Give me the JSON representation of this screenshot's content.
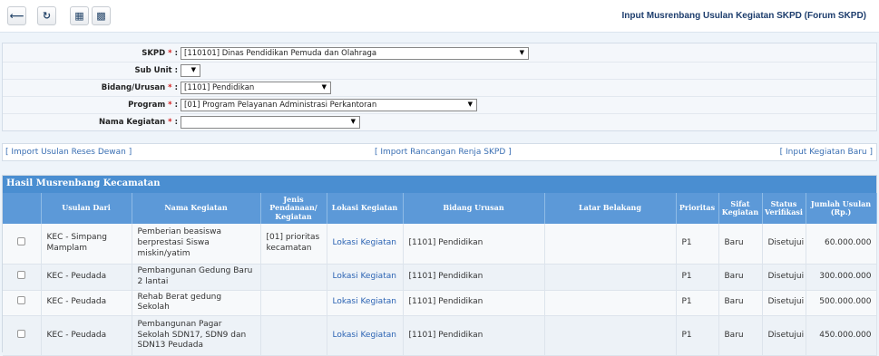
{
  "toolbar": {
    "back_icon": "arrow-left-icon",
    "refresh_icon": "refresh-icon",
    "calc_icon": "calculator-icon",
    "save_icon": "save-icon"
  },
  "page_title": "Input Musrenbang Usulan Kegiatan SKPD (Forum SKPD)",
  "form": {
    "skpd": {
      "label": "SKPD",
      "required": "*",
      "value": "[110101] Dinas Pendidikan Pemuda dan Olahraga"
    },
    "sub_unit": {
      "label": "Sub Unit",
      "value": ""
    },
    "bidang": {
      "label": "Bidang/Urusan",
      "required": "*",
      "value": "[1101] Pendidikan"
    },
    "program": {
      "label": "Program",
      "required": "*",
      "value": "[01] Program Pelayanan Administrasi Perkantoran"
    },
    "kegiatan": {
      "label": "Nama Kegiatan",
      "required": "*",
      "value": ""
    },
    "colon": ":"
  },
  "links": {
    "import_reses": "[ Import Usulan Reses Dewan ]",
    "import_renja": "[ Import Rancangan Renja SKPD ]",
    "input_baru": "[ Input Kegiatan Baru ]"
  },
  "results": {
    "title": "Hasil Musrenbang Kecamatan",
    "columns": [
      "Usulan Dari",
      "Nama Kegiatan",
      "Jenis Pendanaan/ Kegiatan",
      "Lokasi Kegiatan",
      "Bidang Urusan",
      "Latar Belakang",
      "Prioritas",
      "Sifat Kegiatan",
      "Status Verifikasi",
      "Jumlah Usulan (Rp.)"
    ],
    "rows": [
      {
        "usulan_dari": "KEC - Simpang Mamplam",
        "nama": "Pemberian beasiswa berprestasi Siswa miskin/yatim",
        "jenis": "[01] prioritas kecamatan",
        "lokasi": "Lokasi Kegiatan",
        "bidang": "[1101] Pendidikan",
        "latar": "",
        "prioritas": "P1",
        "sifat": "Baru",
        "status": "Disetujui",
        "jumlah": "60.000.000"
      },
      {
        "usulan_dari": "KEC - Peudada",
        "nama": "Pembangunan Gedung Baru 2 lantai",
        "jenis": "",
        "lokasi": "Lokasi Kegiatan",
        "bidang": "[1101] Pendidikan",
        "latar": "",
        "prioritas": "P1",
        "sifat": "Baru",
        "status": "Disetujui",
        "jumlah": "300.000.000"
      },
      {
        "usulan_dari": "KEC - Peudada",
        "nama": "Rehab Berat gedung Sekolah",
        "jenis": "",
        "lokasi": "Lokasi Kegiatan",
        "bidang": "[1101] Pendidikan",
        "latar": "",
        "prioritas": "P1",
        "sifat": "Baru",
        "status": "Disetujui",
        "jumlah": "500.000.000"
      },
      {
        "usulan_dari": "KEC - Peudada",
        "nama": "Pembangunan Pagar Sekolah SDN17, SDN9 dan SDN13 Peudada",
        "jenis": "",
        "lokasi": "Lokasi Kegiatan",
        "bidang": "[1101] Pendidikan",
        "latar": "",
        "prioritas": "P1",
        "sifat": "Baru",
        "status": "Disetujui",
        "jumlah": "450.000.000"
      }
    ]
  }
}
